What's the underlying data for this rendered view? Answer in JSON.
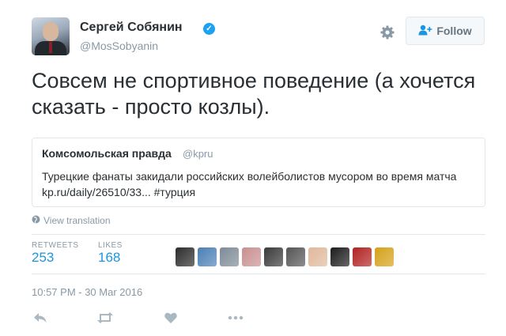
{
  "author": {
    "name": "Сергей Собянин",
    "handle": "@MosSobyanin",
    "verified": true
  },
  "follow_button": {
    "label": "Follow",
    "icon": "add-user-icon"
  },
  "tweet": {
    "text": "Совсем не спортивное поведение (а хочется сказать - просто козлы)."
  },
  "quoted_tweet": {
    "name": "Комсомольская правда",
    "handle": "@kpru",
    "text": "Турецкие фанаты закидали российских волейболистов мусором во время матча kp.ru/daily/26510/33... #турция"
  },
  "translate_link": "View translation",
  "stats": {
    "retweets_label": "RETWEETS",
    "retweets_value": "253",
    "likes_label": "LIKES",
    "likes_value": "168"
  },
  "likers": [
    {
      "color": "#2b2b2b"
    },
    {
      "color": "#4a7fb5"
    },
    {
      "color": "#7d8a96"
    },
    {
      "color": "#c98f8f"
    },
    {
      "color": "#3a3a3a"
    },
    {
      "color": "#555555"
    },
    {
      "color": "#e0b89a"
    },
    {
      "color": "#1c1c1c"
    },
    {
      "color": "#b22222"
    },
    {
      "color": "#d4a017"
    }
  ],
  "timestamp": "10:57 PM - 30 Mar 2016",
  "actions": [
    "reply-icon",
    "retweet-icon",
    "like-icon",
    "more-icon"
  ],
  "colors": {
    "accent": "#1b95e0",
    "verified": "#1da1f2",
    "muted": "#8899a6",
    "text": "#292f33"
  }
}
